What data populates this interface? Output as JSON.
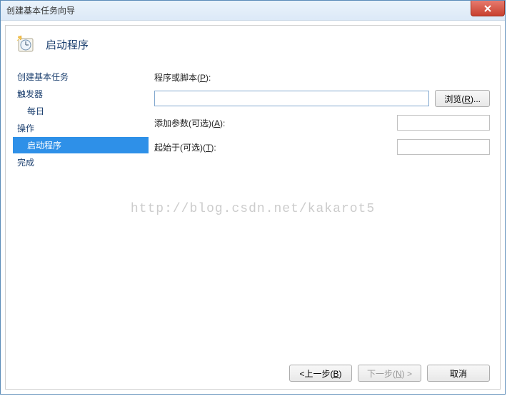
{
  "window": {
    "title": "创建基本任务向导"
  },
  "header": {
    "title": "启动程序"
  },
  "sidebar": {
    "item_create": "创建基本任务",
    "item_trigger": "触发器",
    "item_trigger_sub": "每日",
    "item_action": "操作",
    "item_action_sub": "启动程序",
    "item_finish": "完成"
  },
  "form": {
    "program_label": "程序或脚本(P):",
    "program_label_key": "P",
    "program_value": "",
    "browse_label": "浏览(R)...",
    "args_label": "添加参数(可选)(A):",
    "args_value": "",
    "startin_label": "起始于(可选)(T):",
    "startin_value": ""
  },
  "footer": {
    "back_label": "<上一步(B)",
    "next_label": "下一步(N) >",
    "cancel_label": "取消"
  },
  "watermark": "http://blog.csdn.net/kakarot5"
}
